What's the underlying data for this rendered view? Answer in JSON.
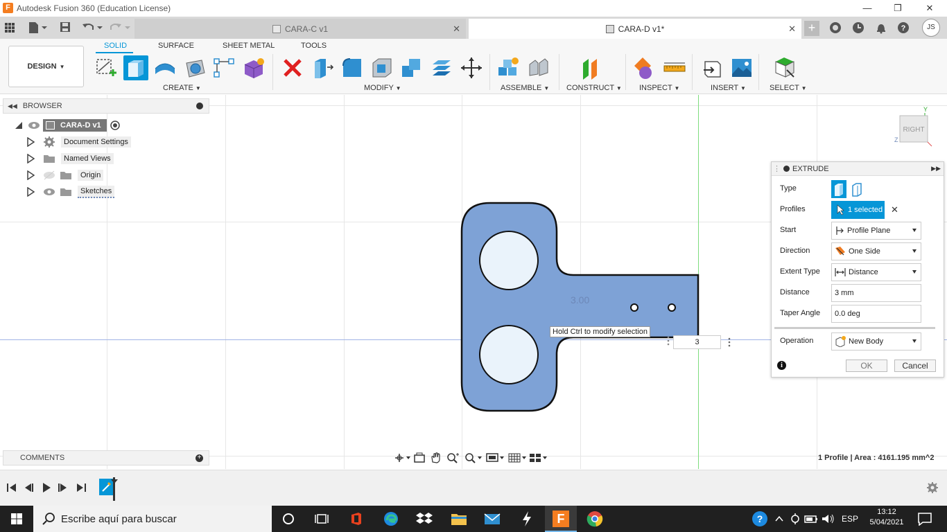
{
  "window": {
    "title": "Autodesk Fusion 360 (Education License)",
    "app_icon_letter": "F",
    "minimize": "—",
    "restore": "❐",
    "close": "✕"
  },
  "tabs": [
    {
      "label": "CARA-C v1",
      "active": false
    },
    {
      "label": "CARA-D v1*",
      "active": true
    }
  ],
  "tabbar_user_initials": "JS",
  "toolbar": {
    "design_label": "DESIGN",
    "workspaces": [
      "SOLID",
      "SURFACE",
      "SHEET METAL",
      "TOOLS"
    ],
    "groups": {
      "create": "CREATE",
      "modify": "MODIFY",
      "assemble": "ASSEMBLE",
      "construct": "CONSTRUCT",
      "inspect": "INSPECT",
      "insert": "INSERT",
      "select": "SELECT"
    }
  },
  "browser": {
    "title": "BROWSER",
    "root": "CARA-D v1",
    "items": [
      "Document Settings",
      "Named Views",
      "Origin",
      "Sketches"
    ]
  },
  "comments": {
    "title": "COMMENTS"
  },
  "viewcube": {
    "face": "RIGHT",
    "axis_y": "Y",
    "axis_z": "Z"
  },
  "canvas": {
    "dimension_text": "3.00",
    "tooltip": "Hold Ctrl to modify selection",
    "distance_input": "3"
  },
  "extrude": {
    "title": "EXTRUDE",
    "type_label": "Type",
    "profiles_label": "Profiles",
    "profiles_value": "1 selected",
    "start_label": "Start",
    "start_value": "Profile Plane",
    "direction_label": "Direction",
    "direction_value": "One Side",
    "extent_label": "Extent Type",
    "extent_value": "Distance",
    "distance_label": "Distance",
    "distance_value": "3 mm",
    "taper_label": "Taper Angle",
    "taper_value": "0.0 deg",
    "operation_label": "Operation",
    "operation_value": "New Body",
    "ok": "OK",
    "cancel": "Cancel"
  },
  "status": {
    "profile_info": "1 Profile | Area : 4161.195 mm^2"
  },
  "taskbar": {
    "search_placeholder": "Escribe aquí para buscar",
    "language": "ESP",
    "time": "13:12",
    "date": "5/04/2021"
  },
  "colors": {
    "accent": "#0696d7",
    "profile_fill": "#7ea2d6",
    "taskbar": "#202020"
  }
}
